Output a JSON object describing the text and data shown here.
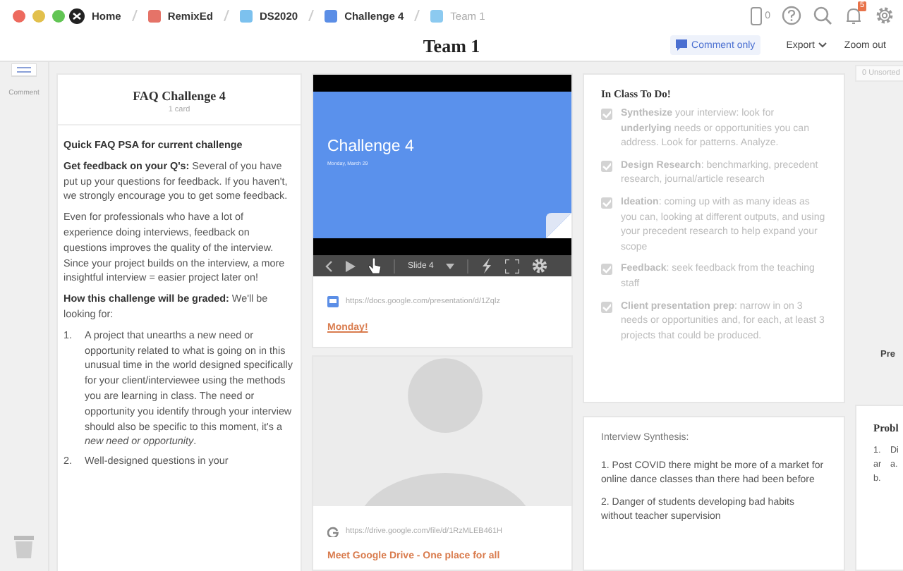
{
  "breadcrumbs": [
    {
      "label": "Home",
      "kind": "home"
    },
    {
      "label": "RemixEd",
      "kind": "board",
      "color": "#e57368",
      "selected": false
    },
    {
      "label": "DS2020",
      "kind": "board",
      "color": "#7cc1ee",
      "selected": false
    },
    {
      "label": "Challenge 4",
      "kind": "board",
      "color": "#5b8ee6",
      "selected": false
    },
    {
      "label": "Team 1",
      "kind": "board",
      "color": "#8ccaf0",
      "selected": true
    }
  ],
  "top_icons": {
    "device_count": "0",
    "notification_badge": "5"
  },
  "title": "Team 1",
  "toolbar": {
    "comment_only": "Comment only",
    "export": "Export",
    "zoom_out": "Zoom out"
  },
  "left_rail": {
    "comment": "Comment"
  },
  "unsorted": "0 Unsorted",
  "faq_column": {
    "title": "FAQ Challenge 4",
    "count": "1 card",
    "paragraphs": [
      "**Quick FAQ PSA for current challenge**",
      "**Get feedback on your Q's:** Several of you have put up your questions for feedback. If you haven't, we strongly encourage you to get some feedback.",
      "Even for professionals who have a lot of experience doing interviews, feedback on questions improves the quality of the interview. Since your project builds on the interview, a more insightful interview = easier project later on!",
      "**How this challenge will be graded:** We'll be looking for:"
    ],
    "list": [
      {
        "marker": "1.",
        "text": "A project that unearths a new need or opportunity related to what is going on in this unusual time in the world designed specifically for your client/interviewee using the methods you are learning in class. The need or opportunity you identify through your interview should also be specific to this moment, it's a *new need or opportunity*."
      },
      {
        "marker": "2.",
        "text": "Well-designed questions in your"
      }
    ]
  },
  "slide_card": {
    "slide_title": "Challenge 4",
    "slide_subtitle": "Monday, March 29",
    "slide_label": "Slide 4",
    "url": "https://docs.google.com/presentation/d/1Zqlz",
    "link": "Monday!"
  },
  "drive_card": {
    "url": "https://drive.google.com/file/d/1RzMLEB461H",
    "link": "Meet Google Drive - One place for all"
  },
  "todo_card": {
    "title": "In Class To Do!",
    "items": [
      {
        "text": "**Synthesize** your interview: look for **underlying** needs or opportunities you can address. Look for patterns. Analyze.",
        "checked": true
      },
      {
        "text": "**Design Research**: benchmarking, precedent research, journal/article research",
        "checked": true
      },
      {
        "text": "**Ideation**: coming up with as many ideas as you can, looking at different outputs, and using your precedent research to help expand your scope",
        "checked": true
      },
      {
        "text": "**Feedback**: seek feedback from the teaching staff",
        "checked": true
      },
      {
        "text": "**Client presentation prep**: narrow in on 3 needs or opportunities and, for each, at least 3 projects that could be produced.",
        "checked": true
      }
    ]
  },
  "interview_card": {
    "title": "Interview Synthesis:",
    "items": [
      "1. Post COVID there might be more of a market for online dance classes than there had been before",
      "2. Danger of students developing bad habits without teacher supervision"
    ]
  },
  "cut_column": {
    "label": "Pre",
    "card_title": "Probl",
    "list": [
      "1.",
      "Di",
      "ar",
      "a.",
      "b."
    ]
  }
}
